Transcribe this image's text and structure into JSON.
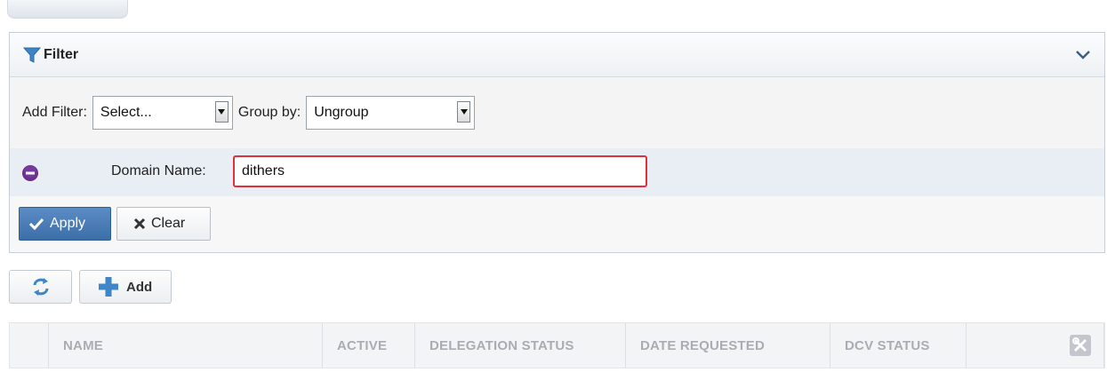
{
  "filter_panel": {
    "title": "Filter",
    "add_filter_label": "Add Filter:",
    "add_filter_value": "Select...",
    "group_by_label": "Group by:",
    "group_by_value": "Ungroup",
    "criterion_label": "Domain Name:",
    "criterion_value": "dithers",
    "apply_label": "Apply",
    "clear_label": "Clear"
  },
  "toolbar": {
    "add_label": "Add"
  },
  "table": {
    "columns": [
      "NAME",
      "ACTIVE",
      "DELEGATION STATUS",
      "DATE REQUESTED",
      "DCV STATUS"
    ]
  },
  "icons": {
    "filter": "funnel-icon",
    "collapse": "chevron-down-icon",
    "remove": "minus-circle-icon",
    "apply": "checkmark-icon",
    "clear": "x-icon",
    "refresh": "refresh-icon",
    "add": "plus-icon",
    "settings": "tools-icon"
  },
  "colors": {
    "accent_blue": "#4a7db8",
    "error_border": "#e0313b",
    "remove_purple": "#6b2d8f"
  }
}
